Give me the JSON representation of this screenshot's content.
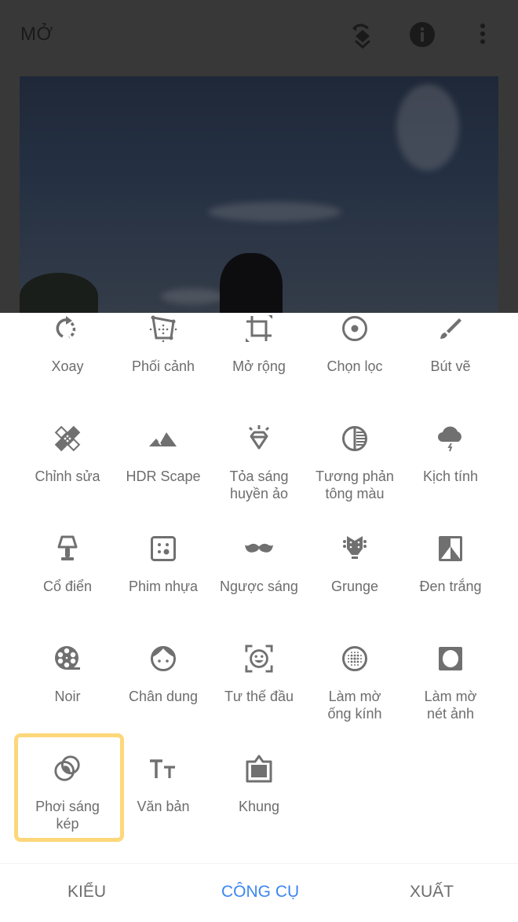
{
  "header": {
    "open_label": "MỞ",
    "icons": [
      "undo-layers-icon",
      "info-icon",
      "more-vert-icon"
    ]
  },
  "photo": {
    "description": "dark sky with clouds, girl's hair and trees at bottom"
  },
  "tools": [
    {
      "label": "Xoay",
      "icon": "rotate-icon"
    },
    {
      "label": "Phối cảnh",
      "icon": "perspective-icon"
    },
    {
      "label": "Mở rộng",
      "icon": "crop-expand-icon"
    },
    {
      "label": "Chọn lọc",
      "icon": "selective-icon"
    },
    {
      "label": "Bút vẽ",
      "icon": "brush-icon"
    },
    {
      "label": "Chỉnh sửa",
      "icon": "healing-icon"
    },
    {
      "label": "HDR Scape",
      "icon": "mountain-icon"
    },
    {
      "label": "Tỏa sáng\nhuyền ảo",
      "icon": "diamond-glow-icon"
    },
    {
      "label": "Tương phản\ntông màu",
      "icon": "tonal-contrast-icon"
    },
    {
      "label": "Kịch tính",
      "icon": "storm-cloud-icon"
    },
    {
      "label": "Cổ điển",
      "icon": "lamp-icon"
    },
    {
      "label": "Phim nhựa",
      "icon": "grainy-film-icon"
    },
    {
      "label": "Ngược sáng",
      "icon": "mustache-icon"
    },
    {
      "label": "Grunge",
      "icon": "guitar-head-icon"
    },
    {
      "label": "Đen trắng",
      "icon": "black-white-icon"
    },
    {
      "label": "Noir",
      "icon": "film-reel-icon"
    },
    {
      "label": "Chân dung",
      "icon": "face-icon"
    },
    {
      "label": "Tư thế đầu",
      "icon": "face-detect-icon"
    },
    {
      "label": "Làm mờ\nống kính",
      "icon": "lens-blur-icon"
    },
    {
      "label": "Làm mờ\nnét ảnh",
      "icon": "vignette-icon"
    },
    {
      "label": "Phơi sáng\nkép",
      "icon": "double-exposure-icon"
    },
    {
      "label": "Văn bản",
      "icon": "text-icon"
    },
    {
      "label": "Khung",
      "icon": "frame-icon"
    }
  ],
  "highlighted_tool": "Phơi sáng\nkép",
  "bottom_nav": {
    "tabs": [
      {
        "label": "KIỂU",
        "active": false
      },
      {
        "label": "CÔNG CỤ",
        "active": true
      },
      {
        "label": "XUẤT",
        "active": false
      }
    ]
  },
  "colors": {
    "accent": "#3d86f0",
    "highlight": "#fdd77a",
    "icon": "#707070",
    "header_bg": "#383838"
  }
}
